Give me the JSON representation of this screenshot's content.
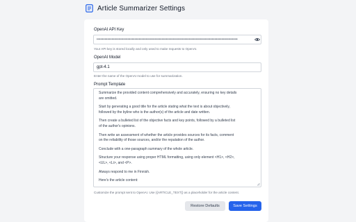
{
  "header": {
    "title": "Article Summarizer Settings",
    "icon": "document-icon"
  },
  "api_key": {
    "label": "OpenAI API Key",
    "value": "••••••••••••••••••••••••••••••••••••••••••••••••••••••••••••••••••••••••••••••••••••••••••••••••••••••••",
    "help": "Your API key is stored locally and only used to make requests to OpenAI."
  },
  "model": {
    "label": "OpenAI Model",
    "value": "gpt-4.1",
    "help": "Enter the name of the OpenAI model to use for summarization."
  },
  "prompt": {
    "label": "Prompt Template",
    "paragraphs": [
      "Summarize the provided content comprehensively and accurately, ensuring no key details\nare omitted.",
      "Start by generating a good title for the article stating what the text is about objectively,\nfollowed by the byline who is the author(s) of the article and date written.",
      "Then create a bulleted list of the objective facts and key points, followed by a bulleted list\nof the author's opinions.",
      "Then write an assessment of whether the article provides sources for its facts, comment\non the reliability of those sources, and/or the reputation of the author.",
      "Conclude with a one-paragraph summary of the whole article.",
      "Structure your response using proper HTML formatting, using only element <H1>, <H2>,\n<UL>, <Li>, and <P>.",
      "Always respond to me in Finnish.",
      "Here's the article content:"
    ],
    "help": "Customize the prompt sent to OpenAI. Use {{ARTICLE_TEXT}} as a placeholder for the article content."
  },
  "actions": {
    "restore_label": "Restore Defaults",
    "save_label": "Save Settings"
  },
  "colors": {
    "primary": "#2563eb",
    "background": "#f3f4f6",
    "card": "#ffffff"
  }
}
